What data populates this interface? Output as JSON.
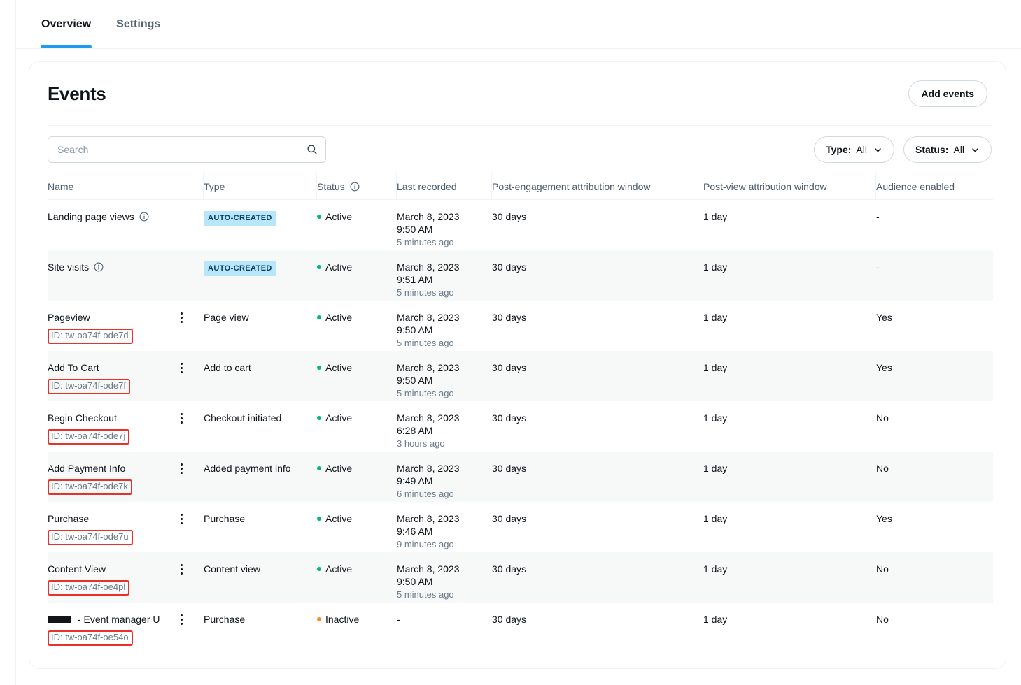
{
  "tabs": [
    {
      "label": "Overview",
      "active": true
    },
    {
      "label": "Settings",
      "active": false
    }
  ],
  "card": {
    "title": "Events",
    "add_button": "Add events"
  },
  "search": {
    "placeholder": "Search",
    "value": "",
    "icon": "search-icon"
  },
  "filters": [
    {
      "key": "Type:",
      "value": "All",
      "icon": "chevron-down-icon"
    },
    {
      "key": "Status:",
      "value": "All",
      "icon": "chevron-down-icon"
    }
  ],
  "table": {
    "columns": [
      {
        "label": "Name"
      },
      {
        "label": "Type"
      },
      {
        "label": "Status",
        "icon": "info-circle-icon"
      },
      {
        "label": "Last recorded"
      },
      {
        "label": "Post-engagement attribution window"
      },
      {
        "label": "Post-view attribution window"
      },
      {
        "label": "Audience enabled"
      }
    ],
    "rows": [
      {
        "name": "Landing page views",
        "name_info_icon": "info-circle-icon",
        "has_kebab": false,
        "id": null,
        "type_badge": "AUTO-CREATED",
        "type": null,
        "status": "Active",
        "status_state": "active",
        "last_date": "March 8, 2023",
        "last_time": "9:50 AM",
        "last_rel": "5 minutes ago",
        "post_engagement": "30 days",
        "post_view": "1 day",
        "audience": "-"
      },
      {
        "name": "Site visits",
        "name_info_icon": "info-circle-icon",
        "has_kebab": false,
        "id": null,
        "type_badge": "AUTO-CREATED",
        "type": null,
        "status": "Active",
        "status_state": "active",
        "last_date": "March 8, 2023",
        "last_time": "9:51 AM",
        "last_rel": "5 minutes ago",
        "post_engagement": "30 days",
        "post_view": "1 day",
        "audience": "-"
      },
      {
        "name": "Pageview",
        "name_info_icon": null,
        "has_kebab": true,
        "id": "ID: tw-oa74f-ode7d",
        "type_badge": null,
        "type": "Page view",
        "status": "Active",
        "status_state": "active",
        "last_date": "March 8, 2023",
        "last_time": "9:50 AM",
        "last_rel": "5 minutes ago",
        "post_engagement": "30 days",
        "post_view": "1 day",
        "audience": "Yes"
      },
      {
        "name": "Add To Cart",
        "name_info_icon": null,
        "has_kebab": true,
        "id": "ID: tw-oa74f-ode7f",
        "type_badge": null,
        "type": "Add to cart",
        "status": "Active",
        "status_state": "active",
        "last_date": "March 8, 2023",
        "last_time": "9:50 AM",
        "last_rel": "5 minutes ago",
        "post_engagement": "30 days",
        "post_view": "1 day",
        "audience": "Yes"
      },
      {
        "name": "Begin Checkout",
        "name_info_icon": null,
        "has_kebab": true,
        "id": "ID: tw-oa74f-ode7j",
        "type_badge": null,
        "type": "Checkout initiated",
        "status": "Active",
        "status_state": "active",
        "last_date": "March 8, 2023",
        "last_time": "6:28 AM",
        "last_rel": "3 hours ago",
        "post_engagement": "30 days",
        "post_view": "1 day",
        "audience": "No"
      },
      {
        "name": "Add Payment Info",
        "name_info_icon": null,
        "has_kebab": true,
        "id": "ID: tw-oa74f-ode7k",
        "type_badge": null,
        "type": "Added payment info",
        "status": "Active",
        "status_state": "active",
        "last_date": "March 8, 2023",
        "last_time": "9:49 AM",
        "last_rel": "6 minutes ago",
        "post_engagement": "30 days",
        "post_view": "1 day",
        "audience": "No"
      },
      {
        "name": "Purchase",
        "name_info_icon": null,
        "has_kebab": true,
        "id": "ID: tw-oa74f-ode7u",
        "type_badge": null,
        "type": "Purchase",
        "status": "Active",
        "status_state": "active",
        "last_date": "March 8, 2023",
        "last_time": "9:46 AM",
        "last_rel": "9 minutes ago",
        "post_engagement": "30 days",
        "post_view": "1 day",
        "audience": "Yes"
      },
      {
        "name": "Content View",
        "name_info_icon": null,
        "has_kebab": true,
        "id": "ID: tw-oa74f-oe4pl",
        "type_badge": null,
        "type": "Content view",
        "status": "Active",
        "status_state": "active",
        "last_date": "March 8, 2023",
        "last_time": "9:50 AM",
        "last_rel": "5 minutes ago",
        "post_engagement": "30 days",
        "post_view": "1 day",
        "audience": "No"
      },
      {
        "name": "- Event manager U",
        "name_redacted": true,
        "name_info_icon": null,
        "has_kebab": true,
        "id": "ID: tw-oa74f-oe54o",
        "type_badge": null,
        "type": "Purchase",
        "status": "Inactive",
        "status_state": "inactive",
        "last_date": "-",
        "last_time": null,
        "last_rel": null,
        "post_engagement": "30 days",
        "post_view": "1 day",
        "audience": "No"
      }
    ]
  },
  "colors": {
    "accent": "#1d9bf0",
    "badge_bg": "#b8e6fb",
    "badge_fg": "#0b3b5c",
    "status_active": "#00ba7c",
    "status_inactive": "#ff8c1a",
    "annotation": "#e8312a",
    "row_alt": "#f7f9f9",
    "border": "#eff3f4"
  }
}
